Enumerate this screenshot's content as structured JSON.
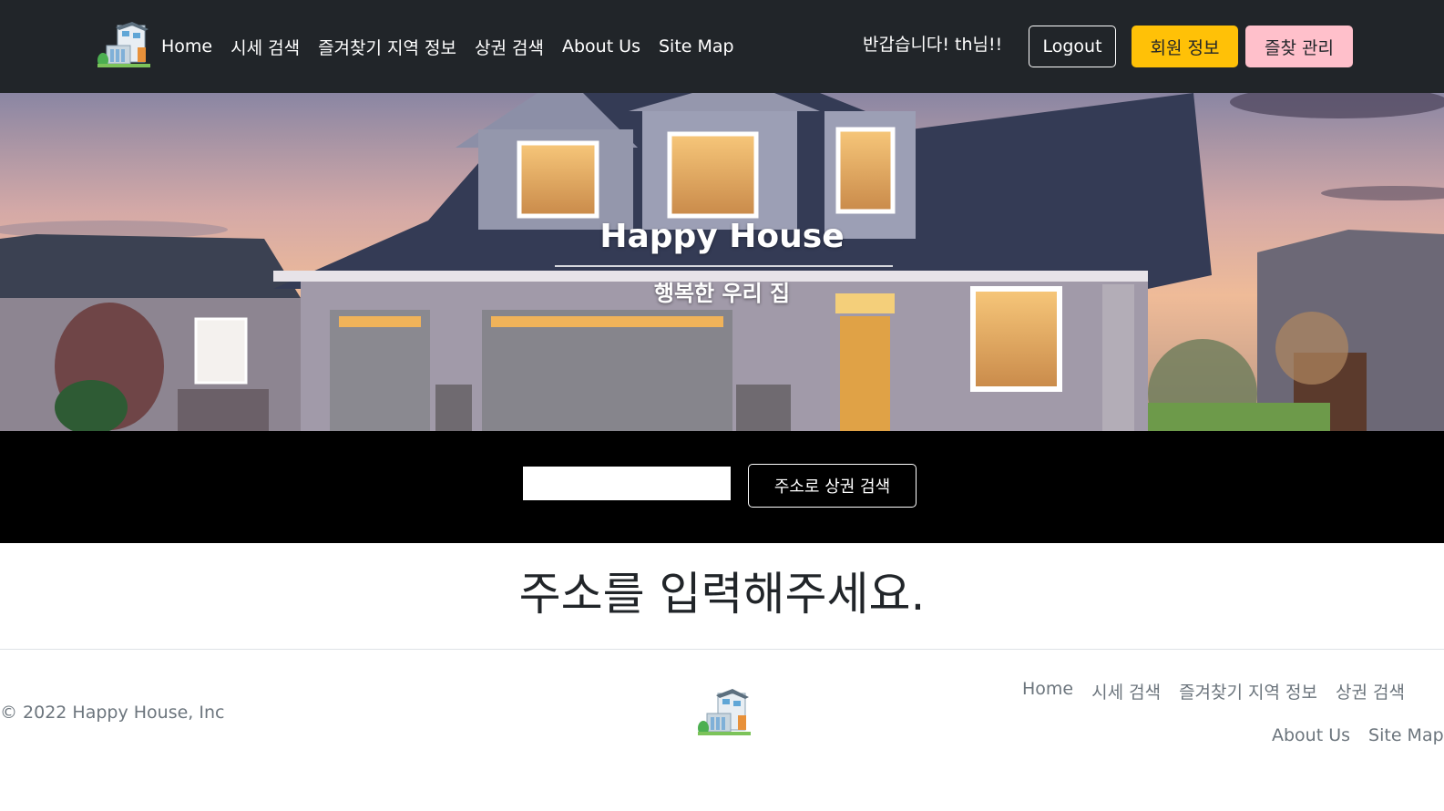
{
  "nav": {
    "links": [
      "Home",
      "시세 검색",
      "즐겨찾기 지역 정보",
      "상권 검색",
      "About Us",
      "Site Map"
    ],
    "greeting": "반갑습니다! th님!!",
    "logout_label": "Logout",
    "member_label": "회원 정보",
    "fav_label": "즐찾 관리"
  },
  "hero": {
    "title": "Happy House",
    "subtitle": "행복한 우리 집"
  },
  "search": {
    "value": "",
    "button_label": "주소로 상권 검색"
  },
  "main": {
    "message": "주소를 입력해주세요."
  },
  "footer": {
    "copyright": "© 2022 Happy House, Inc",
    "links_row1": [
      "Home",
      "시세 검색",
      "즐겨찾기 지역 정보",
      "상권 검색"
    ],
    "links_row2": [
      "About Us",
      "Site Map"
    ]
  },
  "colors": {
    "navbar": "#212529",
    "warning": "#ffc107",
    "pink": "#ffc0cb",
    "search_band": "#000000"
  }
}
